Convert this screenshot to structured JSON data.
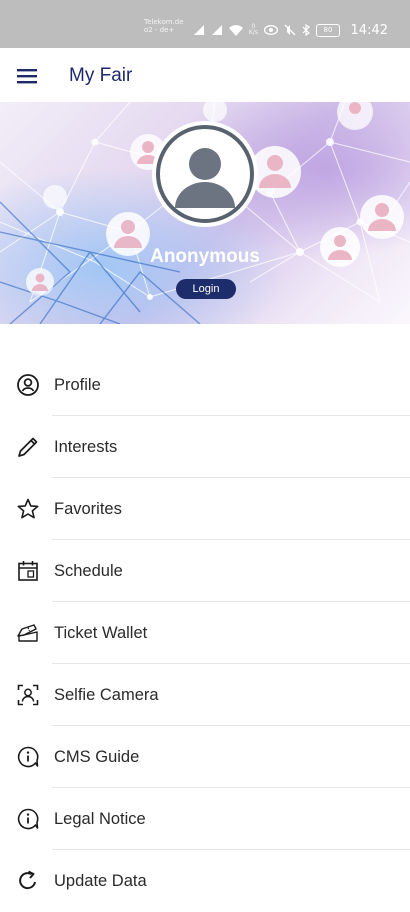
{
  "status_bar": {
    "carrier_line1": "Telekom.de",
    "carrier_line2": "o2 - de+",
    "net_speed_value": "0",
    "net_speed_unit": "K/s",
    "battery": "80",
    "time": "14:42"
  },
  "app_bar": {
    "title": "My Fair",
    "menu_icon": "hamburger-menu-icon"
  },
  "profile_header": {
    "username": "Anonymous",
    "login_label": "Login",
    "avatar_icon": "user-avatar-icon"
  },
  "menu": {
    "items": [
      {
        "label": "Profile",
        "icon": "user-circle-icon"
      },
      {
        "label": "Interests",
        "icon": "pencil-icon"
      },
      {
        "label": "Favorites",
        "icon": "star-icon"
      },
      {
        "label": "Schedule",
        "icon": "calendar-icon"
      },
      {
        "label": "Ticket Wallet",
        "icon": "ticket-icon"
      },
      {
        "label": "Selfie Camera",
        "icon": "selfie-camera-icon"
      },
      {
        "label": "CMS Guide",
        "icon": "info-icon"
      },
      {
        "label": "Legal Notice",
        "icon": "info-icon"
      },
      {
        "label": "Update Data",
        "icon": "refresh-icon"
      }
    ]
  },
  "colors": {
    "primary": "#1d2d6b",
    "status_bar": "#bdbdbd",
    "text": "#2a2a2a"
  }
}
